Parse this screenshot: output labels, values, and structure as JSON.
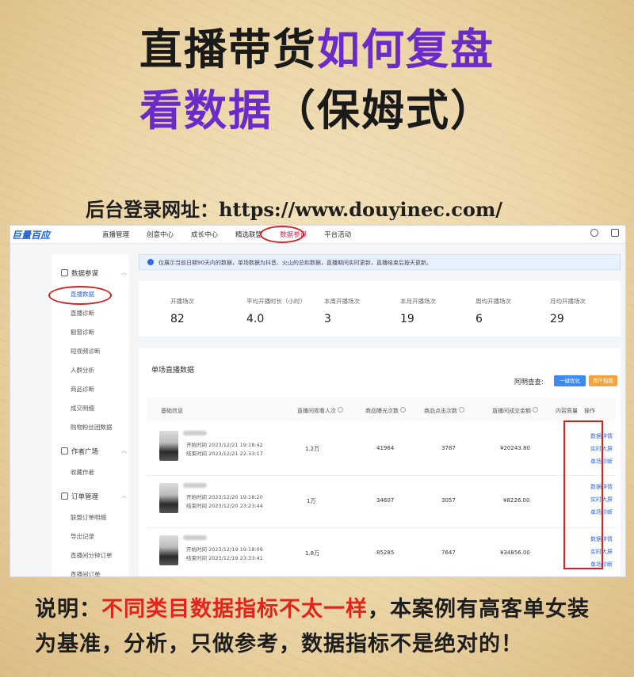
{
  "title": {
    "line1_black": "直播带货",
    "line1_accent": "如何复盘",
    "line2_accent": "看数据",
    "line2_black": "（保姆式）"
  },
  "url_line": "后台登录网址：https://www.douyinec.com/",
  "screenshot": {
    "logo": "巨量百应",
    "topnav": [
      "直播管理",
      "创意中心",
      "成长中心",
      "精选联盟",
      "数据参谋",
      "平台活动"
    ],
    "topnav_active": "数据参谋",
    "sidebar": {
      "group1": "数据参谋",
      "items1": [
        "直播数据",
        "直播诊断",
        "橱窗诊断",
        "短视频诊断",
        "人群分析",
        "商品诊断",
        "成交明细",
        "购物粉丝团数据"
      ],
      "group2": "作者广场",
      "items2": [
        "收藏作者"
      ],
      "group3": "订单管理",
      "items3": [
        "联盟订单明细",
        "导出记录",
        "直播间分钟订单",
        "直播间订单"
      ]
    },
    "notice": "仅展示当前日期90天内的数据，单场数据为抖音、火山的总和数据，直播期间实时更新，直播结束后按天更新。",
    "stats": [
      {
        "label": "开播场次",
        "value": "82"
      },
      {
        "label": "平均开播时长（小时）",
        "value": "4.0"
      },
      {
        "label": "本周开播场次",
        "value": "3"
      },
      {
        "label": "本月开播场次",
        "value": "19"
      },
      {
        "label": "周均开播场次",
        "value": "6"
      },
      {
        "label": "月均开播场次",
        "value": "29"
      }
    ],
    "table": {
      "title": "单场直播数据",
      "hint": "阿明查查:",
      "btn_blue": "一键优化",
      "btn_orange": "用户指南",
      "headers": [
        "基础信息",
        "直播间观看人次",
        "商品曝光次数",
        "商品点击次数",
        "直播间成交金额",
        "内容质量",
        "操作"
      ],
      "rows": [
        {
          "start": "开始时间  2023/12/21 19:18:42",
          "end": "结束时间  2023/12/21 22:33:17",
          "views": "1.2万",
          "exposure": "41964",
          "clicks": "3787",
          "gmv": "¥20243.80"
        },
        {
          "start": "开始时间  2023/12/20 19:18:20",
          "end": "结束时间  2023/12/20 23:23:44",
          "views": "1万",
          "exposure": "34607",
          "clicks": "3057",
          "gmv": "¥8226.00"
        },
        {
          "start": "开始时间  2023/12/19 19:18:09",
          "end": "结束时间  2023/12/19 23:33:41",
          "views": "1.8万",
          "exposure": "85285",
          "clicks": "7647",
          "gmv": "¥34856.00"
        }
      ],
      "ops": [
        "数据详情",
        "实时大屏",
        "单场诊断"
      ]
    }
  },
  "note": {
    "prefix": "说明：",
    "red": "不同类目数据指标不太一样",
    "rest": "，本案例有高客单女装为基准，分析，只做参考，数据指标不是绝对的！"
  }
}
